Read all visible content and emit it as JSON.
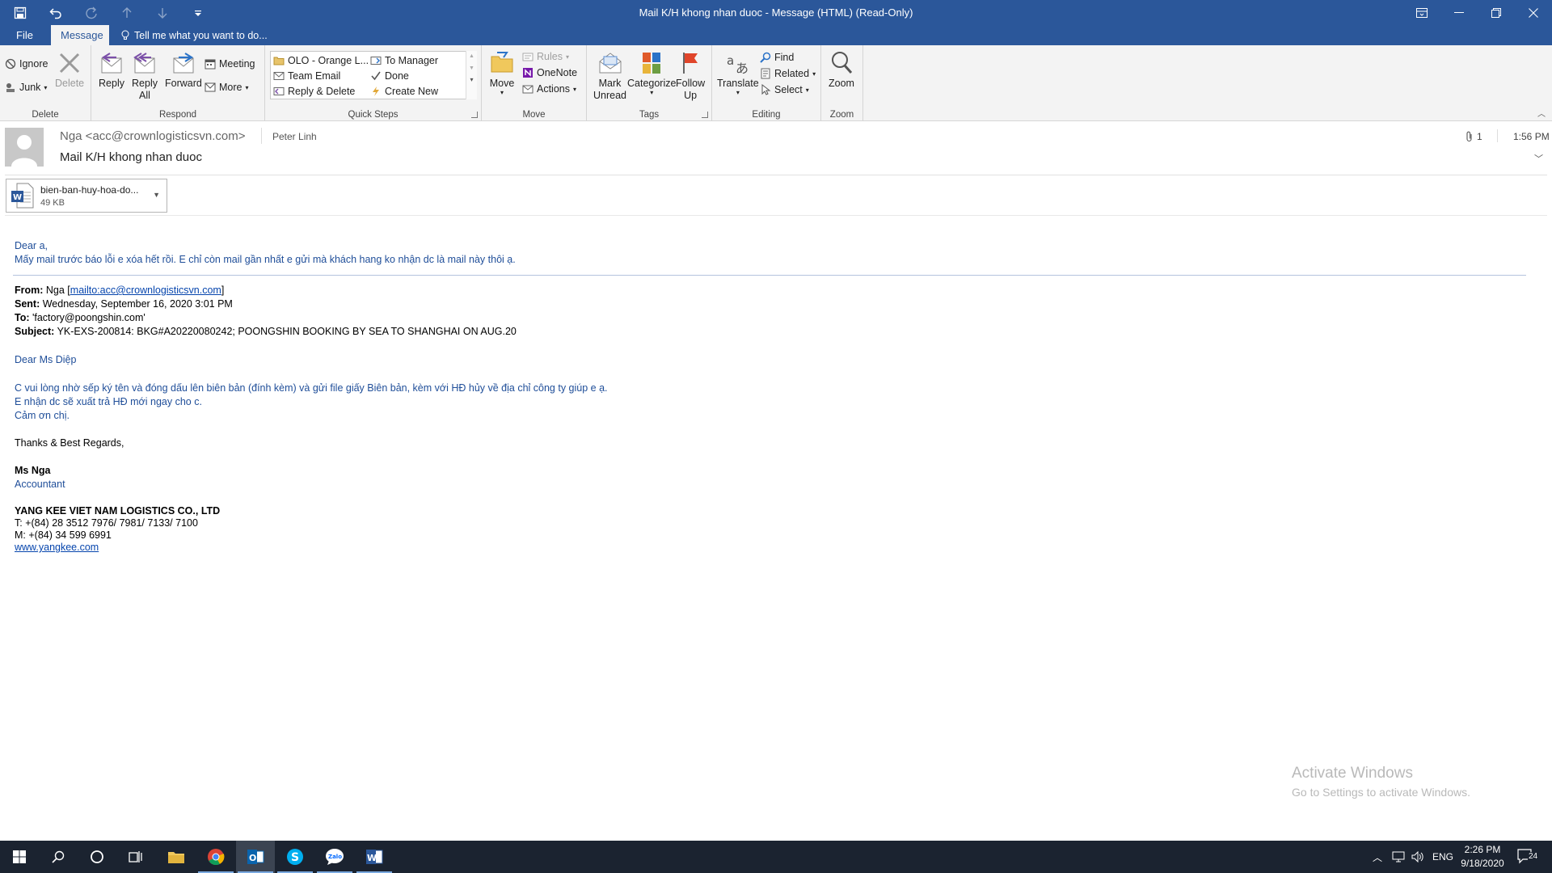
{
  "window": {
    "title": "Mail K/H khong nhan duoc - Message (HTML) (Read-Only)"
  },
  "tabs": {
    "file": "File",
    "message": "Message",
    "tell_me": "Tell me what you want to do..."
  },
  "ribbon": {
    "delete_group": {
      "label": "Delete",
      "ignore": "Ignore",
      "junk": "Junk",
      "delete": "Delete"
    },
    "respond_group": {
      "label": "Respond",
      "reply": "Reply",
      "reply_all_1": "Reply",
      "reply_all_2": "All",
      "forward": "Forward",
      "meeting": "Meeting",
      "more": "More"
    },
    "quick_steps": {
      "label": "Quick Steps",
      "items": [
        "OLO - Orange L...",
        "Team Email",
        "Reply & Delete",
        "To Manager",
        "Done",
        "Create New"
      ]
    },
    "move_group": {
      "label": "Move",
      "move": "Move",
      "rules": "Rules",
      "onenote": "OneNote",
      "actions": "Actions"
    },
    "tags_group": {
      "label": "Tags",
      "mark_unread_1": "Mark",
      "mark_unread_2": "Unread",
      "categorize": "Categorize",
      "follow_up_1": "Follow",
      "follow_up_2": "Up"
    },
    "editing_group": {
      "label": "Editing",
      "translate": "Translate",
      "find": "Find",
      "related": "Related",
      "select": "Select"
    },
    "zoom_group": {
      "label": "Zoom",
      "zoom": "Zoom"
    }
  },
  "message": {
    "from": "Nga <acc@crownlogisticsvn.com>",
    "to": "Peter Linh",
    "subject": "Mail K/H khong nhan duoc",
    "attachment_count": "1",
    "time": "1:56 PM",
    "attachment": {
      "name": "bien-ban-huy-hoa-do...",
      "size": "49 KB"
    }
  },
  "body": {
    "greeting": "Dear a,",
    "line1": "Mấy mail trước báo lỗi e xóa hết rồi. E chỉ còn mail gần nhất e gửi mà khách hang ko nhận dc là mail này thôi ạ.",
    "from_label": "From:",
    "from_name": "Nga [",
    "from_link": "mailto:acc@crownlogisticsvn.com",
    "from_close": "]",
    "sent_label": "Sent:",
    "sent_value": "Wednesday, September 16, 2020 3:01 PM",
    "to_label": "To:",
    "to_value": "'factory@poongshin.com'",
    "subject_label": "Subject:",
    "subject_value": "YK-EXS-200814: BKG#A20220080242; POONGSHIN BOOKING BY SEA TO SHANGHAI ON AUG.20",
    "dear": "Dear Ms Diệp",
    "p1": "C vui lòng nhờ sếp ký tên và đóng dấu lên biên bản (đính kèm) và gửi file giấy Biên bản, kèm với HĐ hủy về địa chỉ công ty giúp e ạ.",
    "p2": "E nhận dc sẽ xuất trả HĐ mới ngay cho c.",
    "p3": "Cảm ơn chị.",
    "thanks": "Thanks & Best Regards,",
    "sig_name": "Ms Nga",
    "sig_title": "Accountant",
    "company": "YANG KEE VIET NAM LOGISTICS CO., LTD",
    "tel": "T: +(84) 28 3512 7976/ 7981/ 7133/ 7100",
    "mobile": "M: +(84) 34 599 6991",
    "website": "www.yangkee.com"
  },
  "watermark": {
    "line1": "Activate Windows",
    "line2": "Go to Settings to activate Windows."
  },
  "taskbar": {
    "lang": "ENG",
    "time": "2:26 PM",
    "date": "9/18/2020",
    "notifications": "24"
  }
}
